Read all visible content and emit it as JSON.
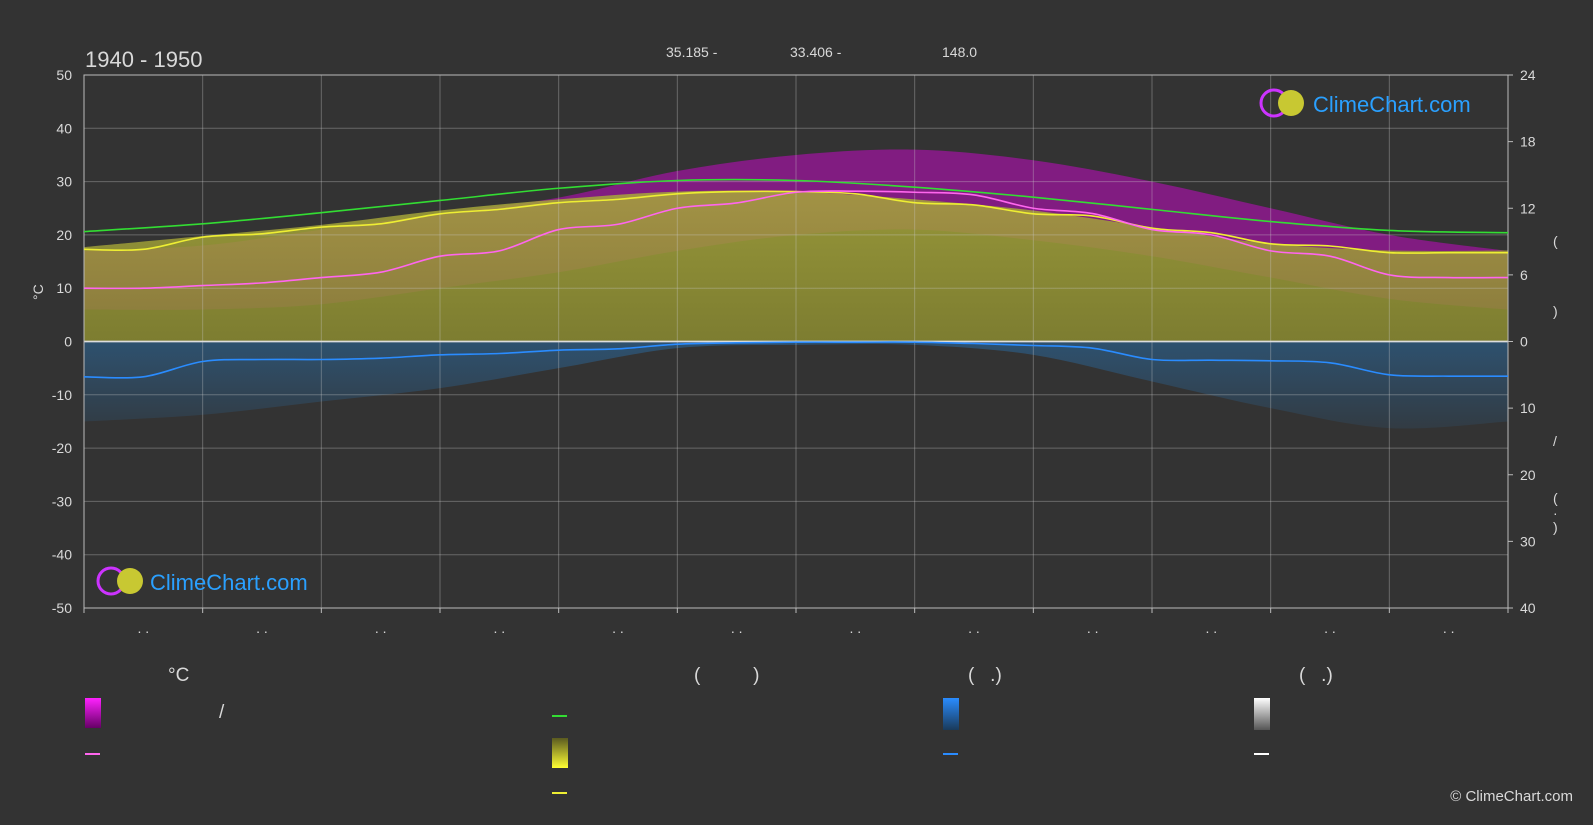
{
  "header": {
    "period": "1940 - 1950",
    "coord_lat": "35.185 -",
    "coord_lon": "33.406 -",
    "elevation": "148.0"
  },
  "brand": {
    "logo_text": "ClimeChart.com",
    "copyright": "© ClimeChart.com"
  },
  "axes": {
    "left_unit": "°C",
    "right_labels_upper": [
      "(",
      ")"
    ],
    "right_labels_lower": [
      "/",
      "(",
      "·",
      ")"
    ],
    "month_tick_labels": [
      ". .",
      ". .",
      ". .",
      ". .",
      ". .",
      ". .",
      ". .",
      ". .",
      ". .",
      ". .",
      ". .",
      ". ."
    ]
  },
  "legend": {
    "col1_header": "°C",
    "col2_header": "(          )",
    "col3_header": "(   .)",
    "col4_header": "(   .)",
    "slash": "/"
  },
  "colors": {
    "background": "#333333",
    "max_temp_band": "#e000e0",
    "mean_temp_line": "#ff66ee",
    "daylight_line": "#33dd33",
    "sunshine_band": "#b0b030",
    "sunshine_line": "#eeee33",
    "precip_band": "#2a7fc8",
    "precip_line": "#2a8cff",
    "snow_line": "#ffffff",
    "accent_blue": "#2aa0ff"
  },
  "chart_data": {
    "type": "area",
    "title": "1940 - 1950",
    "ylabel": "°C",
    "ylim": [
      -50,
      50
    ],
    "y_ticks": [
      50,
      40,
      30,
      20,
      10,
      0,
      -10,
      -20,
      -30,
      -40,
      -50
    ],
    "y2_upper_ticks": [
      24,
      18,
      12,
      6,
      0
    ],
    "y2_upper_range": [
      0,
      24
    ],
    "y2_lower_ticks": [
      0,
      10,
      20,
      30,
      40
    ],
    "y2_lower_range": [
      0,
      40
    ],
    "x_months": 12,
    "grid": true,
    "series": [
      {
        "name": "daylight",
        "axis": "right-upper",
        "x": [
          0,
          1,
          2,
          3,
          4,
          5,
          6,
          7,
          8,
          9,
          10,
          11,
          12
        ],
        "values": [
          9.9,
          10.6,
          11.6,
          12.7,
          13.8,
          14.5,
          14.5,
          13.9,
          13.0,
          11.9,
          10.8,
          10.0,
          9.8
        ]
      },
      {
        "name": "sunshine",
        "axis": "right-upper",
        "x": [
          0,
          0.5,
          1,
          1.5,
          2,
          2.5,
          3,
          3.5,
          4,
          4.5,
          5,
          5.5,
          6,
          6.5,
          7,
          7.5,
          8,
          8.5,
          9,
          9.5,
          10,
          10.5,
          11,
          11.5,
          12
        ],
        "values": [
          8.3,
          8.3,
          9.4,
          9.7,
          10.3,
          10.6,
          11.5,
          11.9,
          12.5,
          12.8,
          13.3,
          13.5,
          13.5,
          13.3,
          12.5,
          12.3,
          11.5,
          11.3,
          10.2,
          9.8,
          8.8,
          8.6,
          8.0,
          8.0,
          8.0
        ]
      },
      {
        "name": "mean_temp",
        "axis": "left",
        "x": [
          0,
          0.5,
          1,
          1.5,
          2,
          2.5,
          3,
          3.5,
          4,
          4.5,
          5,
          5.5,
          6,
          6.5,
          7,
          7.5,
          8,
          8.5,
          9,
          9.5,
          10,
          10.5,
          11,
          11.5,
          12
        ],
        "values": [
          10,
          10,
          10.5,
          11,
          12,
          13,
          16,
          17,
          21,
          22,
          25,
          26,
          28,
          28.2,
          28,
          27.5,
          25,
          24,
          21,
          20,
          17,
          16,
          12.5,
          12,
          12
        ]
      },
      {
        "name": "precipitation",
        "axis": "right-lower",
        "x": [
          0,
          0.5,
          1,
          1.5,
          2,
          2.5,
          3,
          3.5,
          4,
          4.5,
          5,
          5.5,
          6,
          6.5,
          7,
          7.5,
          8,
          8.5,
          9,
          9.5,
          10,
          10.5,
          11,
          11.5,
          12
        ],
        "values": [
          5.3,
          5.3,
          3.0,
          2.7,
          2.7,
          2.5,
          2.0,
          1.8,
          1.3,
          1.1,
          0.4,
          0.2,
          0.1,
          0.1,
          0.1,
          0.3,
          0.6,
          1.0,
          2.7,
          2.8,
          2.9,
          3.2,
          5.0,
          5.2,
          5.2
        ]
      }
    ],
    "bands": [
      {
        "name": "temp_range",
        "axis": "left",
        "x": [
          0,
          1,
          2,
          3,
          4,
          5,
          6,
          7,
          8,
          9,
          10,
          11,
          12
        ],
        "low": [
          6,
          6,
          7,
          10,
          13,
          17,
          20,
          21,
          19,
          16,
          12,
          8,
          6
        ],
        "high": [
          17,
          18,
          21,
          24,
          27,
          32,
          35,
          36,
          34,
          30,
          25,
          20,
          17
        ]
      },
      {
        "name": "sunshine_fill",
        "axis": "right-upper",
        "x": [
          0,
          1,
          2,
          3,
          4,
          5,
          6,
          7,
          8,
          9,
          10,
          11,
          12
        ],
        "high": [
          8.5,
          9.5,
          10.5,
          11.8,
          12.8,
          13.5,
          13.5,
          12.8,
          11.8,
          10.3,
          8.8,
          8.2,
          8.2
        ]
      },
      {
        "name": "precip_fill",
        "axis": "right-lower",
        "x": [
          0,
          1,
          2,
          3,
          4,
          5,
          6,
          7,
          8,
          9,
          10,
          11,
          12
        ],
        "high": [
          12,
          11,
          9,
          7,
          4,
          1,
          0.5,
          0.5,
          2,
          6,
          10,
          13,
          12
        ]
      }
    ]
  }
}
